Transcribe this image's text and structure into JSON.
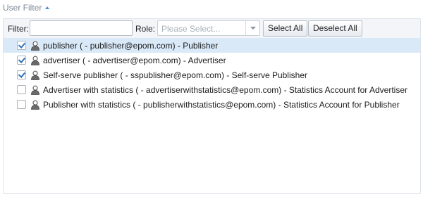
{
  "section": {
    "title": "User Filter"
  },
  "toolbar": {
    "filter_label": "Filter:",
    "filter_value": "",
    "role_label": "Role:",
    "role_placeholder": "Please Select...",
    "select_all_label": "Select All",
    "deselect_all_label": "Deselect All"
  },
  "users": [
    {
      "text": "publisher ( - publisher@epom.com) - Publisher",
      "checked": true,
      "selected": true
    },
    {
      "text": "advertiser ( - advertiser@epom.com) - Advertiser",
      "checked": true,
      "selected": false
    },
    {
      "text": "Self-serve publisher ( - sspublisher@epom.com) - Self-serve Publisher",
      "checked": true,
      "selected": false
    },
    {
      "text": "Advertiser with statistics ( - advertiserwithstatistics@epom.com) - Statistics Account for Advertiser",
      "checked": false,
      "selected": false
    },
    {
      "text": "Publisher with statistics ( - publisherwithstatistics@epom.com) - Statistics Account for Publisher",
      "checked": false,
      "selected": false
    }
  ],
  "colors": {
    "accent": "#2d6fc0",
    "row_selected": "#d9e9f8",
    "header_text": "#7d8a99"
  },
  "icons": {
    "row_icon": "user-icon",
    "header_icon": "caret-up-icon"
  }
}
